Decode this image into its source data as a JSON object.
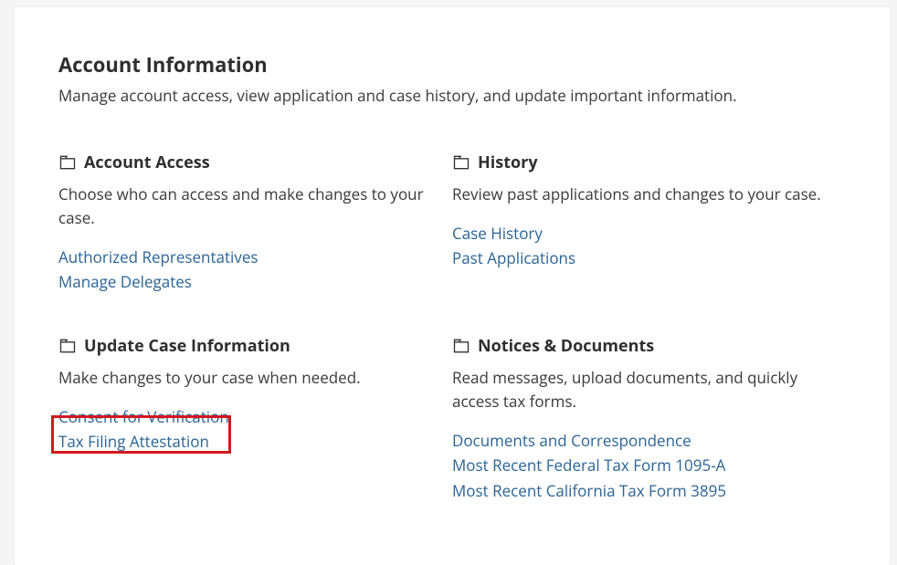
{
  "header": {
    "title": "Account Information",
    "subtitle": "Manage account access, view application and case history, and update important information."
  },
  "sections": {
    "access": {
      "title": "Account Access",
      "desc": "Choose who can access and make changes to your case.",
      "links": {
        "auth_reps": "Authorized Representatives",
        "manage_delegates": "Manage Delegates"
      }
    },
    "history": {
      "title": "History",
      "desc": "Review past applications and changes to your case.",
      "links": {
        "case_history": "Case History",
        "past_apps": "Past Applications"
      }
    },
    "update": {
      "title": "Update Case Information",
      "desc": "Make changes to your case when needed.",
      "links": {
        "consent": "Consent for Verification",
        "tax_filing": "Tax Filing Attestation"
      }
    },
    "docs": {
      "title": "Notices & Documents",
      "desc": "Read messages, upload documents, and quickly access tax forms.",
      "links": {
        "docs_corr": "Documents and Correspondence",
        "fed_1095a": "Most Recent Federal Tax Form 1095-A",
        "ca_3895": "Most Recent California Tax Form 3895"
      }
    }
  }
}
